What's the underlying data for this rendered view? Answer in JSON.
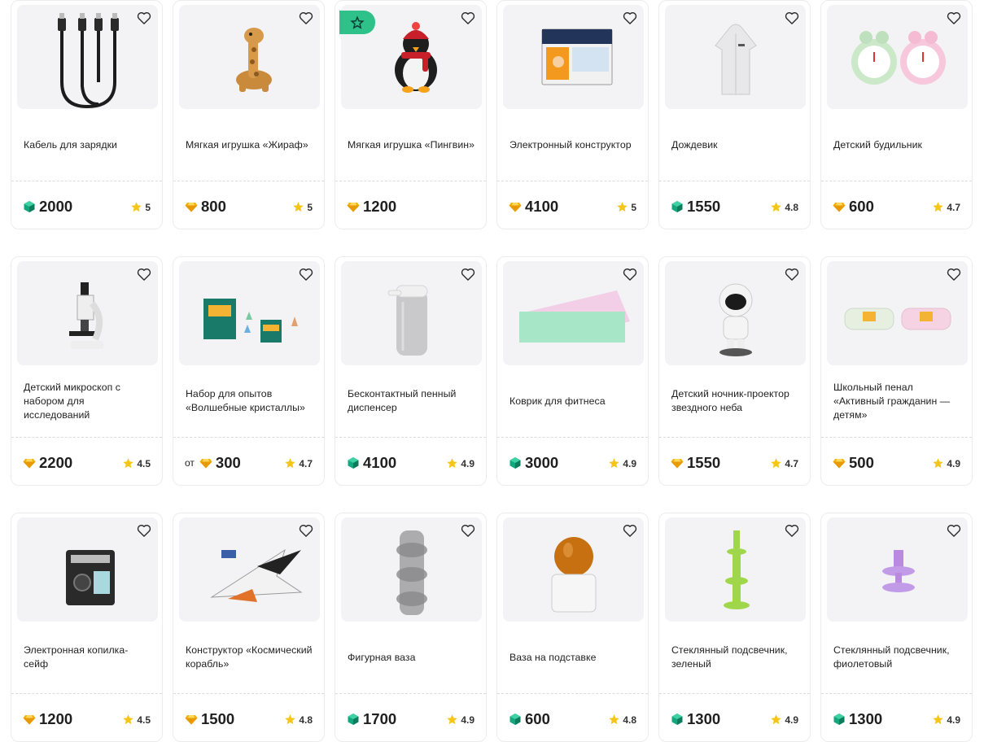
{
  "products": [
    {
      "title": "Кабель для зарядки",
      "price": "2000",
      "from": "",
      "currency": "gem",
      "rating": "5",
      "badge": false,
      "icon": "charging-cable-image"
    },
    {
      "title": "Мягкая игрушка «Жираф»",
      "price": "800",
      "from": "",
      "currency": "diamond",
      "rating": "5",
      "badge": false,
      "icon": "giraffe-toy-image"
    },
    {
      "title": "Мягкая игрушка «Пингвин»",
      "price": "1200",
      "from": "",
      "currency": "diamond",
      "rating": "",
      "badge": true,
      "icon": "penguin-toy-image"
    },
    {
      "title": "Электронный конструктор",
      "price": "4100",
      "from": "",
      "currency": "diamond",
      "rating": "5",
      "badge": false,
      "icon": "electronic-kit-image"
    },
    {
      "title": "Дождевик",
      "price": "1550",
      "from": "",
      "currency": "gem",
      "rating": "4.8",
      "badge": false,
      "icon": "raincoat-image"
    },
    {
      "title": "Детский будильник",
      "price": "600",
      "from": "",
      "currency": "diamond",
      "rating": "4.7",
      "badge": false,
      "icon": "alarm-clock-image"
    },
    {
      "title": "Детский микроскоп с набором для исследований",
      "price": "2200",
      "from": "",
      "currency": "diamond",
      "rating": "4.5",
      "badge": false,
      "icon": "microscope-image"
    },
    {
      "title": "Набор для опытов «Волшебные кристаллы»",
      "price": "300",
      "from": "от",
      "currency": "diamond",
      "rating": "4.7",
      "badge": false,
      "icon": "crystal-kit-image"
    },
    {
      "title": "Бесконтактный пенный диспенсер",
      "price": "4100",
      "from": "",
      "currency": "gem",
      "rating": "4.9",
      "badge": false,
      "icon": "dispenser-image"
    },
    {
      "title": "Коврик для фитнеса",
      "price": "3000",
      "from": "",
      "currency": "gem",
      "rating": "4.9",
      "badge": false,
      "icon": "fitness-mat-image"
    },
    {
      "title": "Детский ночник-проектор звездного неба",
      "price": "1550",
      "from": "",
      "currency": "diamond",
      "rating": "4.7",
      "badge": false,
      "icon": "astronaut-projector-image"
    },
    {
      "title": "Школьный пенал «Активный гражданин — детям»",
      "price": "500",
      "from": "",
      "currency": "diamond",
      "rating": "4.9",
      "badge": false,
      "icon": "pencil-case-image"
    },
    {
      "title": "Электронная копилка-сейф",
      "price": "1200",
      "from": "",
      "currency": "diamond",
      "rating": "4.5",
      "badge": false,
      "icon": "piggy-bank-safe-image"
    },
    {
      "title": "Конструктор «Космический корабль»",
      "price": "1500",
      "from": "",
      "currency": "diamond",
      "rating": "4.8",
      "badge": false,
      "icon": "spaceship-kit-image"
    },
    {
      "title": "Фигурная ваза",
      "price": "1700",
      "from": "",
      "currency": "gem",
      "rating": "4.9",
      "badge": false,
      "icon": "vase-image"
    },
    {
      "title": "Ваза на подставке",
      "price": "600",
      "from": "",
      "currency": "gem",
      "rating": "4.8",
      "badge": false,
      "icon": "vase-on-stand-image"
    },
    {
      "title": "Стеклянный подсвечник, зеленый",
      "price": "1300",
      "from": "",
      "currency": "gem",
      "rating": "4.9",
      "badge": false,
      "icon": "green-candlestick-image"
    },
    {
      "title": "Стеклянный подсвечник, фиолетовый",
      "price": "1300",
      "from": "",
      "currency": "gem",
      "rating": "4.9",
      "badge": false,
      "icon": "purple-candlestick-image"
    }
  ],
  "colors": {
    "gem": "#13a77e",
    "diamond": "#f2b20f",
    "star": "#f5c518",
    "badge": "#2ec28a"
  }
}
